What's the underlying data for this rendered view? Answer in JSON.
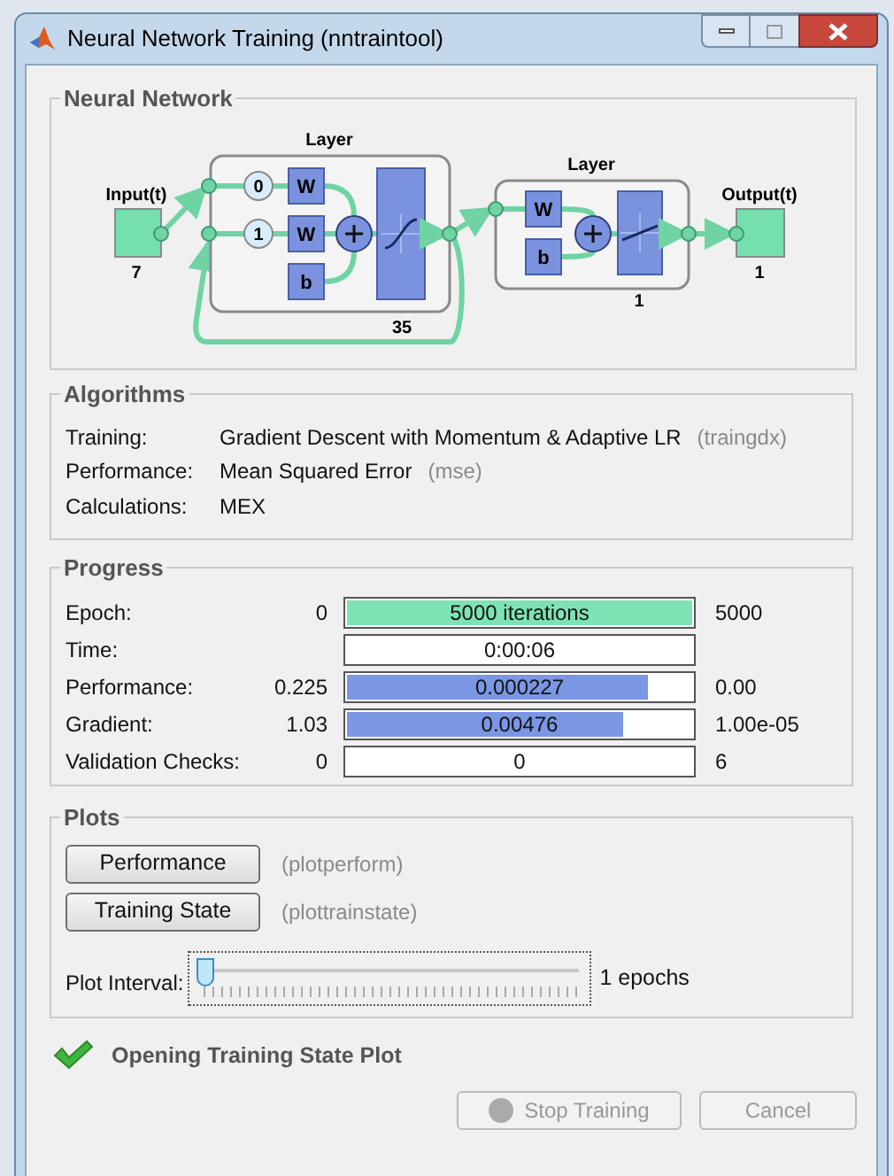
{
  "window": {
    "title": "Neural Network Training (nntraintool)"
  },
  "neural_network": {
    "title": "Neural Network",
    "input": {
      "label": "Input(t)",
      "size": "7"
    },
    "layers": [
      {
        "title": "Layer",
        "size": "35",
        "inputs": [
          {
            "delay": "0",
            "weight": "W"
          },
          {
            "delay": "1",
            "weight": "W"
          }
        ],
        "bias": "b",
        "kind": "sigmoid"
      },
      {
        "title": "Layer",
        "size": "1",
        "inputs": [
          {
            "weight": "W"
          }
        ],
        "bias": "b",
        "kind": "linear"
      }
    ],
    "output": {
      "label": "Output(t)",
      "size": "1"
    }
  },
  "algorithms": {
    "title": "Algorithms",
    "rows": [
      {
        "label": "Training:",
        "value": "Gradient Descent with Momentum & Adaptive LR",
        "hint": "(traingdx)"
      },
      {
        "label": "Performance:",
        "value": "Mean Squared Error",
        "hint": "(mse)"
      },
      {
        "label": "Calculations:",
        "value": "MEX"
      }
    ]
  },
  "progress": {
    "title": "Progress",
    "rows": [
      {
        "label": "Epoch:",
        "start": "0",
        "value": "5000 iterations",
        "end": "5000",
        "level": 1,
        "color": "#7de3b4"
      },
      {
        "label": "Time:",
        "value": "0:00:06"
      },
      {
        "label": "Performance:",
        "start": "0.225",
        "value": "0.000227",
        "end": "0.00",
        "level": 0.87,
        "color": "#7b96e3"
      },
      {
        "label": "Gradient:",
        "start": "1.03",
        "value": "0.00476",
        "end": "1.00e-05",
        "level": 0.8,
        "color": "#7b96e3"
      },
      {
        "label": "Validation Checks:",
        "start": "0",
        "value": "0",
        "end": "6"
      }
    ]
  },
  "plots": {
    "title": "Plots",
    "buttons": [
      {
        "label": "Performance",
        "hint": "(plotperform)"
      },
      {
        "label": "Training State",
        "hint": "(plottrainstate)"
      }
    ],
    "interval": {
      "label": "Plot Interval:",
      "level": 0,
      "reading": "1 epochs"
    }
  },
  "status": {
    "text": "Opening Training State Plot",
    "ok": true
  },
  "buttons": [
    {
      "kind": "stop",
      "label": "Stop Training",
      "disabled": true
    },
    {
      "kind": "plain",
      "label": "Cancel",
      "disabled": true
    }
  ]
}
